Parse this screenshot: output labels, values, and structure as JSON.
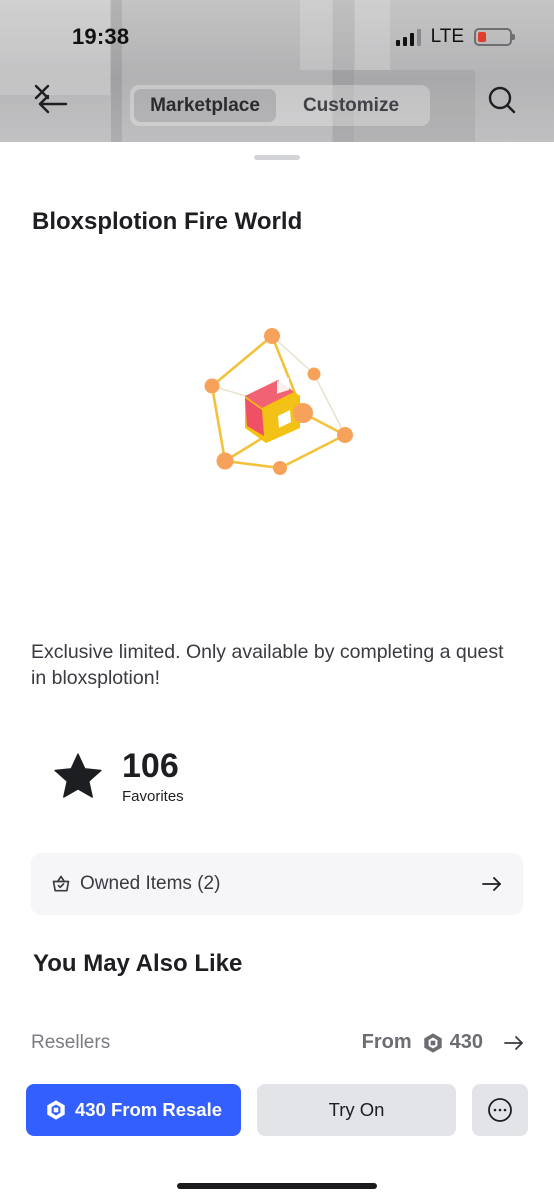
{
  "status_bar": {
    "time": "19:38",
    "network": "LTE"
  },
  "header": {
    "tabs": [
      {
        "label": "Marketplace",
        "active": true
      },
      {
        "label": "Customize",
        "active": false
      }
    ],
    "back_icon": "back-arrow-icon",
    "search_icon": "search-icon"
  },
  "item": {
    "title": "Bloxsplotion Fire World",
    "description": "Exclusive limited. Only available by completing a quest in bloxsplotion!",
    "favorites_count": "106",
    "favorites_label": "Favorites"
  },
  "owned": {
    "label": "Owned Items (2)"
  },
  "recommendations": {
    "title": "You May Also Like"
  },
  "resellers": {
    "label": "Resellers",
    "from_label": "From",
    "price": "430"
  },
  "actions": {
    "buy_label": "430 From Resale",
    "try_on_label": "Try On"
  },
  "colors": {
    "accent": "#335fff",
    "battery_low": "#e33b2c"
  }
}
